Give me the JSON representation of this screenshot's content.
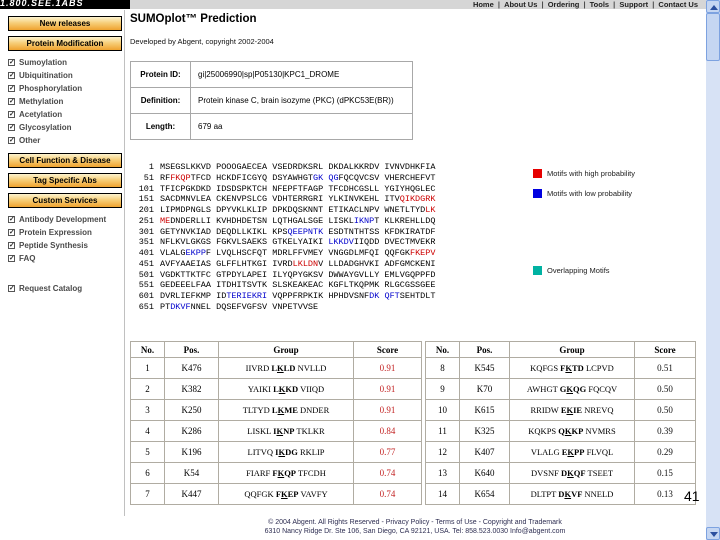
{
  "page": {
    "logo": "1.800.SEE.1ABS",
    "page_number": "41"
  },
  "nav": {
    "separator": "|",
    "links": [
      "Home",
      "About Us",
      "Ordering",
      "Tools",
      "Support",
      "Contact Us"
    ]
  },
  "sidebar": {
    "entries": [
      {
        "type": "button",
        "label": "New releases"
      },
      {
        "type": "button",
        "label": "Protein Modification"
      },
      {
        "type": "item",
        "label": "Sumoylation",
        "mt": 2
      },
      {
        "type": "item",
        "label": "Ubiquitination"
      },
      {
        "type": "item",
        "label": "Phosphorylation"
      },
      {
        "type": "item",
        "label": "Methylation"
      },
      {
        "type": "item",
        "label": "Acetylation"
      },
      {
        "type": "item",
        "label": "Glycosylation"
      },
      {
        "type": "item",
        "label": "Other"
      },
      {
        "type": "button",
        "label": "Cell Function & Disease",
        "mt": 6
      },
      {
        "type": "button",
        "label": "Tag Specific Abs"
      },
      {
        "type": "button",
        "label": "Custom Services"
      },
      {
        "type": "item",
        "label": "Antibody Development",
        "mt": 4
      },
      {
        "type": "item",
        "label": "Protein Expression"
      },
      {
        "type": "item",
        "label": "Peptide Synthesis"
      },
      {
        "type": "item",
        "label": "FAQ"
      },
      {
        "type": "item",
        "label": "Request Catalog",
        "mt": 17
      }
    ]
  },
  "main": {
    "title": "SUMOplot™ Prediction",
    "subtitle": "Developed by Abgent, copyright 2002-2004",
    "info_table": {
      "rows": [
        {
          "label": "Protein ID:",
          "value": "gi|25006990|sp|P05130|KPC1_DROME"
        },
        {
          "label": "Definition:",
          "value": "Protein kinase C, brain isozyme (PKC) (dPKC53E(BR))"
        },
        {
          "label": "Length:",
          "value": "679 aa"
        }
      ]
    },
    "sequence": {
      "lines": [
        {
          "n": "1",
          "t": "MSEGSLKKVD POOOGAECEA VSEDRDKSRL DKDALKKRDV IVNVDHKFIA"
        },
        {
          "n": "51",
          "t": "RF{r:FKQP}TFCD HCKDFICGYQ DSYAWHGT{b:GK} {b:QG}FQCQVCSV VHERCHEFVT"
        },
        {
          "n": "101",
          "t": "TFICPGKDKD IDSDSPKTCH NFEPFTFAGP TFCDHCGSLL YGIYHQGLEC"
        },
        {
          "n": "151",
          "t": "SACDMNVLEA CKENVPSLCG VDHTERRGRI YLKINVKEHL ITV{r:QIKDGRK}"
        },
        {
          "n": "201",
          "t": "LIPMDPNGLS DPYVKLKLIP DPKDQSKNNT ETIKACLNPV WNETLTYD{r:LK}"
        },
        {
          "n": "251",
          "t": "{r:ME}DNDERLLI KVHDHDETSN LQTHGALSGE LISKL{b:IKNP}T KLKREHLLDQ"
        },
        {
          "n": "301",
          "t": "GETYNVKIAD DEQDLLKIKL KPS{b:QEEPNTK} ESDTNTHTSS KFDKIRATDF"
        },
        {
          "n": "351",
          "t": "NFLKVLGKGS FGKVLSAEKS GTKELYAIKI {b:LKKDV}IIQDD DVECTMVEKR"
        },
        {
          "n": "401",
          "t": "VLALG{b:EKPP}F LVQLHSCFQT MDRLFFVMEY VNGGDLMFQI QQFGK{r:FKEPV}"
        },
        {
          "n": "451",
          "t": "AVFYAAEIAS GLFFLHTKGI IVRD{r:LKLDN}V LLDADGHVKI ADFGMCKENI"
        },
        {
          "n": "501",
          "t": "VGDKTTKTFC GTPDYLAPEI ILYQPYGKSV DWWAYGVLLY EMLVGQPPFD"
        },
        {
          "n": "551",
          "t": "GEDEEELFAA ITDHITSVTK SLSKEAKEAC KGFLTKQPMK RLGCGSSGEE"
        },
        {
          "n": "601",
          "t": "DVRLIEFKMP ID{b:TERIEKRI} VQPPFRPKIK HPHDVSNF{b:DK} {b:QFT}SEHTDLT"
        },
        {
          "n": "651",
          "t": "PT{b:DKVF}NNEL DQSEFVGFSV VNPETVVSE"
        }
      ]
    },
    "legend": {
      "items": [
        {
          "color": "#e60000",
          "label": "Motifs with high probability"
        },
        {
          "color": "#0000e0",
          "label": "Motifs with low probability"
        },
        {
          "color": "#00b2a2",
          "label": "Overlapping Motifs"
        }
      ]
    },
    "tables": [
      {
        "headers": [
          "No.",
          "Pos.",
          "Group",
          "Score"
        ],
        "score_color": "#c22222",
        "rows": [
          [
            "1",
            "K476",
            "IIVRD LKLD NVLLD",
            "0.91"
          ],
          [
            "2",
            "K382",
            "YAIKI LKKD VIIQD",
            "0.91"
          ],
          [
            "3",
            "K250",
            "TLTYD LKME DNDER",
            "0.91"
          ],
          [
            "4",
            "K286",
            "LISKL IKNP TKLKR",
            "0.84"
          ],
          [
            "5",
            "K196",
            "LITVQ IKDG RKLIP",
            "0.77"
          ],
          [
            "6",
            "K54",
            "FIARF FKQP TFCDH",
            "0.74"
          ],
          [
            "7",
            "K447",
            "QQFGK FKEP VAVFY",
            "0.74"
          ]
        ]
      },
      {
        "headers": [
          "No.",
          "Pos.",
          "Group",
          "Score"
        ],
        "score_color": "#111111",
        "rows": [
          [
            "8",
            "K545",
            "KQFGS FKTD LCPVD",
            "0.51"
          ],
          [
            "9",
            "K70",
            "AWHGT GKQG FQCQV",
            "0.50"
          ],
          [
            "10",
            "K615",
            "RRIDW EKIE NREVQ",
            "0.50"
          ],
          [
            "11",
            "K325",
            "KQKPS QKKP NVMRS",
            "0.39"
          ],
          [
            "12",
            "K407",
            "VLALG EKPP FLVQL",
            "0.29"
          ],
          [
            "13",
            "K640",
            "DVSNF DKQF TSEET",
            "0.15"
          ],
          [
            "14",
            "K654",
            "DLTPT DKVF NNELD",
            "0.13"
          ]
        ]
      }
    ]
  },
  "footer": {
    "line1": "© 2004 Abgent. All Rights Reserved - Privacy Policy - Terms of Use - Copyright and Trademark",
    "line2": "6310 Nancy Ridge Dr. Ste 106, San Diego, CA 92121, USA. Tel: 858.523.0030 Info@abgent.com"
  }
}
